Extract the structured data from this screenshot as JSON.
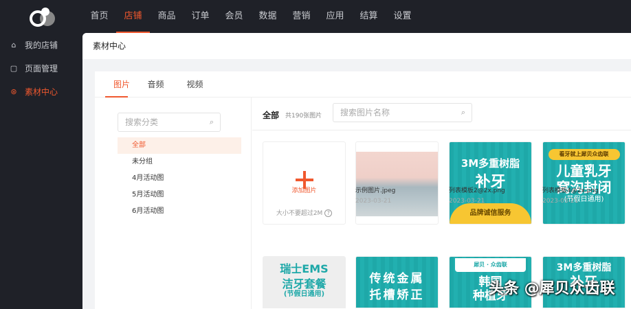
{
  "nav": {
    "items": [
      "首页",
      "店铺",
      "商品",
      "订单",
      "会员",
      "数据",
      "营销",
      "应用",
      "结算",
      "设置"
    ],
    "active": 1
  },
  "sidebar": {
    "items": [
      {
        "label": "我的店铺",
        "icon": "store-icon"
      },
      {
        "label": "页面管理",
        "icon": "page-icon"
      },
      {
        "label": "素材中心",
        "icon": "material-icon"
      }
    ],
    "active": 2
  },
  "page_title": "素材中心",
  "tabs": [
    "图片",
    "音频",
    "视频"
  ],
  "category_search": {
    "placeholder": "搜索分类"
  },
  "categories": [
    "全部",
    "未分组",
    "4月活动图",
    "5月活动图",
    "6月活动图"
  ],
  "header": {
    "current": "全部",
    "count": "共190张图片",
    "search_placeholder": "搜索图片名称"
  },
  "upload": {
    "hint": "大小不要超过2M",
    "label": "添加图片"
  },
  "images": [
    {
      "name": "示例图片.jpeg",
      "date": "2023-03-21"
    },
    {
      "name": "列表模板2@2x.png",
      "date": "2023-03-21",
      "lines": [
        "3M多重树脂",
        "补牙",
        "品牌诚信服务"
      ]
    },
    {
      "name": "列表模板4@2x.png",
      "date": "2023-03-21",
      "lines": [
        "看牙就上犀贝众齿联",
        "儿童乳牙",
        "窝沟封闭",
        "(节假日通用)"
      ]
    }
  ],
  "row2": [
    {
      "lines": [
        "瑞士EMS",
        "洁牙套餐",
        "(节假日通用)"
      ]
    },
    {
      "lines": [
        "传统金属",
        "托槽矫正"
      ]
    },
    {
      "lines": [
        "犀贝 · 众齿联",
        "韩国",
        "种植牙"
      ]
    },
    {
      "lines": [
        "3M多重树脂",
        "补牙"
      ]
    }
  ],
  "watermark": "头条 @犀贝众齿联",
  "colors": {
    "accent": "#f0582e",
    "dark": "#1f2128",
    "teal": "#1ea8a8"
  }
}
